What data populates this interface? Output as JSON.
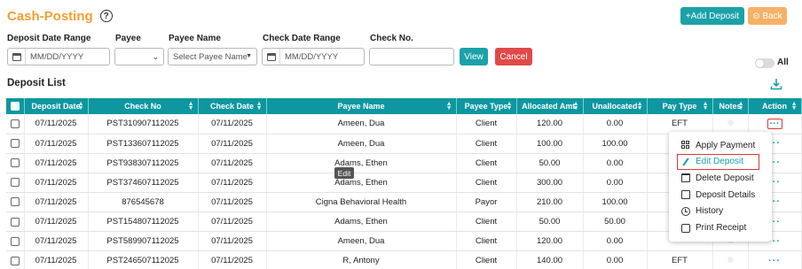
{
  "header": {
    "title": "Cash-Posting",
    "help_glyph": "?",
    "add_deposit_label": "+Add Deposit",
    "back_label": "⊝ Back"
  },
  "filters": {
    "deposit_date_range": {
      "label": "Deposit Date Range",
      "placeholder": "MM/DD/YYYY"
    },
    "payee": {
      "label": "Payee",
      "value": ""
    },
    "payee_name": {
      "label": "Payee Name",
      "placeholder": "Select Payee Name"
    },
    "check_date_range": {
      "label": "Check Date Range",
      "placeholder": "MM/DD/YYYY"
    },
    "check_no": {
      "label": "Check No.",
      "value": ""
    },
    "view_label": "View",
    "cancel_label": "Cancel",
    "all_toggle_label": "All"
  },
  "deposit_list": {
    "title": "Deposit List",
    "columns": [
      "Deposit Date",
      "Check No",
      "Check Date",
      "Payee Name",
      "Payee Type",
      "Allocated Amt.",
      "Unallocated",
      "Pay Type",
      "Notes",
      "Action"
    ],
    "rows": [
      {
        "deposit_date": "07/11/2025",
        "check_no": "PST310907112025",
        "check_date": "07/11/2025",
        "payee_name": "Ameen, Dua",
        "payee_type": "Client",
        "allocated": "120.00",
        "unallocated": "0.00",
        "pay_type": "EFT"
      },
      {
        "deposit_date": "07/11/2025",
        "check_no": "PST133607112025",
        "check_date": "07/11/2025",
        "payee_name": "Ameen, Dua",
        "payee_type": "Client",
        "allocated": "100.00",
        "unallocated": "100.00",
        "pay_type": ""
      },
      {
        "deposit_date": "07/11/2025",
        "check_no": "PST938307112025",
        "check_date": "07/11/2025",
        "payee_name": "Adams, Ethen",
        "payee_type": "Client",
        "allocated": "50.00",
        "unallocated": "0.00",
        "pay_type": ""
      },
      {
        "deposit_date": "07/11/2025",
        "check_no": "PST374607112025",
        "check_date": "07/11/2025",
        "payee_name": "Adams, Ethen",
        "payee_type": "Client",
        "allocated": "300.00",
        "unallocated": "0.00",
        "pay_type": ""
      },
      {
        "deposit_date": "07/11/2025",
        "check_no": "876545678",
        "check_date": "07/11/2025",
        "payee_name": "Cigna Behavioral Health",
        "payee_type": "Payor",
        "allocated": "210.00",
        "unallocated": "100.00",
        "pay_type": ""
      },
      {
        "deposit_date": "07/11/2025",
        "check_no": "PST154807112025",
        "check_date": "07/11/2025",
        "payee_name": "Adams, Ethen",
        "payee_type": "Client",
        "allocated": "50.00",
        "unallocated": "50.00",
        "pay_type": ""
      },
      {
        "deposit_date": "07/11/2025",
        "check_no": "PST589907112025",
        "check_date": "07/11/2025",
        "payee_name": "Ameen, Dua",
        "payee_type": "Client",
        "allocated": "120.00",
        "unallocated": "0.00",
        "pay_type": ""
      },
      {
        "deposit_date": "07/11/2025",
        "check_no": "PST246507112025",
        "check_date": "07/11/2025",
        "payee_name": "R, Antony",
        "payee_type": "Client",
        "allocated": "140.00",
        "unallocated": "0.00",
        "pay_type": "EFT"
      }
    ],
    "action_glyph": "···"
  },
  "tooltip": {
    "text": "Edit"
  },
  "action_menu": {
    "items": [
      {
        "label": "Apply Payment",
        "icon": "grid-icon"
      },
      {
        "label": "Edit Deposit",
        "icon": "pencil-icon"
      },
      {
        "label": "Delete Deposit",
        "icon": "trash-icon"
      },
      {
        "label": "Deposit Details",
        "icon": "document-icon"
      },
      {
        "label": "History",
        "icon": "clock-icon"
      },
      {
        "label": "Print Receipt",
        "icon": "printer-icon"
      }
    ]
  },
  "colors": {
    "brand_title": "#f0a030",
    "teal": "#0e97a0",
    "cancel_red": "#e04a4a",
    "back_orange": "#f6b168"
  }
}
